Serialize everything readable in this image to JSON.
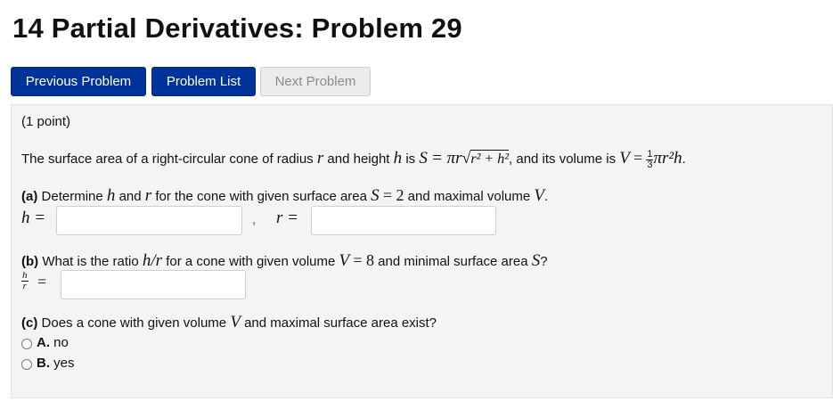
{
  "page": {
    "title": "14 Partial Derivatives: Problem 29"
  },
  "nav": {
    "previous_label": "Previous Problem",
    "list_label": "Problem List",
    "next_label": "Next Problem"
  },
  "problem": {
    "points": "(1 point)",
    "intro_prefix": "The surface area of a right-circular cone of radius",
    "intro_and_height": "and height",
    "intro_is": "is",
    "intro_and_volume": ", and its volume is",
    "var_r": "r",
    "var_h": "h",
    "var_S": "S",
    "var_V": "V",
    "surface_formula_pi_r": "= πr",
    "surface_radicand": "r² + h²",
    "volume_lead": "=",
    "volume_frac_num": "1",
    "volume_frac_den": "3",
    "volume_rest": "πr²h",
    "period": "."
  },
  "part_a": {
    "tag": "(a)",
    "prompt_1": "Determine",
    "prompt_2": "and",
    "prompt_3": "for the cone with given surface area",
    "prompt_value": "= 2",
    "prompt_4": "and maximal volume",
    "field_h_label": "h =",
    "separator": ",",
    "field_r_label": "r =",
    "h_value": "",
    "r_value": ""
  },
  "part_b": {
    "tag": "(b)",
    "prompt_1": "What is the ratio",
    "ratio_expr": "h/r",
    "prompt_2": "for a cone with given volume",
    "prompt_value": "= 8",
    "prompt_3": "and minimal surface area",
    "qmark": "?",
    "frac_num": "h",
    "frac_den": "r",
    "field_label": "=",
    "value": ""
  },
  "part_c": {
    "tag": "(c)",
    "prompt_1": "Does a cone with given volume",
    "prompt_2": "and maximal surface area exist?",
    "options": [
      {
        "letter": "A.",
        "text": "no"
      },
      {
        "letter": "B.",
        "text": "yes"
      }
    ]
  }
}
